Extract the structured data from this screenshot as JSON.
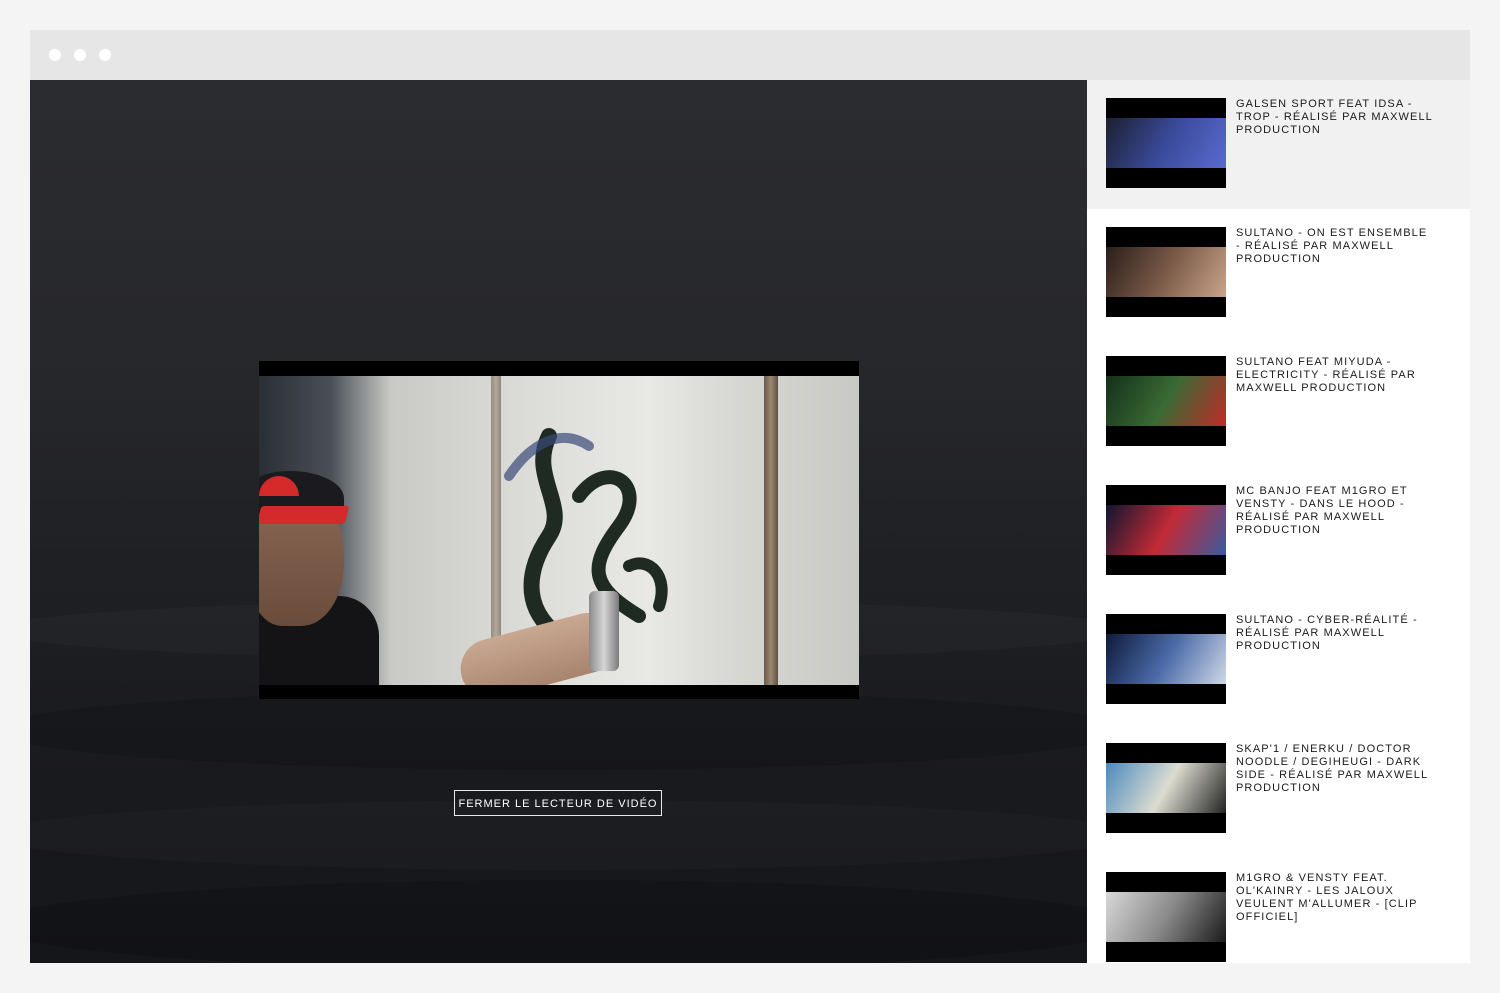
{
  "player": {
    "close_label": "FERMER LE LECTEUR DE VIDÉO"
  },
  "playlist": {
    "items": [
      {
        "title": "GALSEN SPORT FEAT IDSA - TROP - RÉALISÉ PAR MAXWELL PRODUCTION",
        "active": true,
        "thumb_colors": [
          "#1c2030",
          "#3a4a9a",
          "#5a6bd0"
        ]
      },
      {
        "title": "SULTANO - ON EST ENSEMBLE - RÉALISÉ PAR MAXWELL PRODUCTION",
        "active": false,
        "thumb_colors": [
          "#2a1e1a",
          "#7a5a48",
          "#caa48a"
        ]
      },
      {
        "title": "SULTANO FEAT MIYUDA - ELECTRICITY - RÉALISÉ PAR MAXWELL PRODUCTION",
        "active": false,
        "thumb_colors": [
          "#14301a",
          "#3a6a34",
          "#c02a2a"
        ]
      },
      {
        "title": "MC BANJO FEAT M1GRO ET VENSTY - DANS LE HOOD - RÉALISÉ PAR MAXWELL PRODUCTION",
        "active": false,
        "thumb_colors": [
          "#0e1630",
          "#c22a36",
          "#3a5aa0"
        ]
      },
      {
        "title": "SULTANO - CYBER-RÉALITÉ - RÉALISÉ PAR MAXWELL PRODUCTION",
        "active": false,
        "thumb_colors": [
          "#0e1a3a",
          "#4a6aa8",
          "#cfd8e6"
        ]
      },
      {
        "title": "SKAP'1 / ENERKU / DOCTOR NOODLE / DEGIHEUGI - DARK SIDE - RÉALISÉ PAR MAXWELL PRODUCTION",
        "active": false,
        "thumb_colors": [
          "#4a8ac0",
          "#dcdcd0",
          "#222222"
        ]
      },
      {
        "title": "M1GRO & VENSTY FEAT. OL'KAINRY - LES JALOUX VEULENT M'ALLUMER - [CLIP OFFICIEL]",
        "active": false,
        "thumb_colors": [
          "#d8d8d8",
          "#8a8a8a",
          "#1a1a1a"
        ]
      }
    ]
  }
}
